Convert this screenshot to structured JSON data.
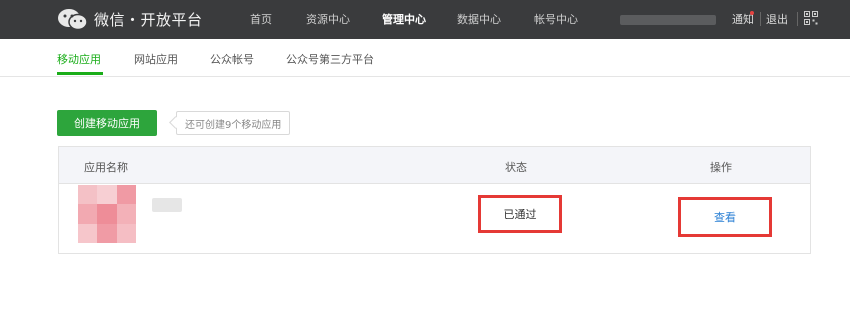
{
  "header": {
    "logo_title": "微信・开放平台",
    "nav": [
      "首页",
      "资源中心",
      "管理中心",
      "数据中心",
      "帐号中心"
    ],
    "active_nav": "管理中心",
    "notice_label": "通知",
    "logout_label": "退出"
  },
  "subnav": {
    "tabs": [
      "移动应用",
      "网站应用",
      "公众帐号",
      "公众号第三方平台"
    ],
    "active": "移动应用"
  },
  "actions": {
    "create_label": "创建移动应用",
    "quota_text": "还可创建9个移动应用"
  },
  "table": {
    "columns": [
      "应用名称",
      "状态",
      "操作"
    ],
    "rows": [
      {
        "status": "已通过",
        "action": "查看"
      }
    ]
  },
  "colors": {
    "accent": "#1aad19",
    "button": "#2da53c",
    "highlight_box": "#e53935",
    "link": "#2a7fd4",
    "topbar": "#3a3b3d"
  }
}
